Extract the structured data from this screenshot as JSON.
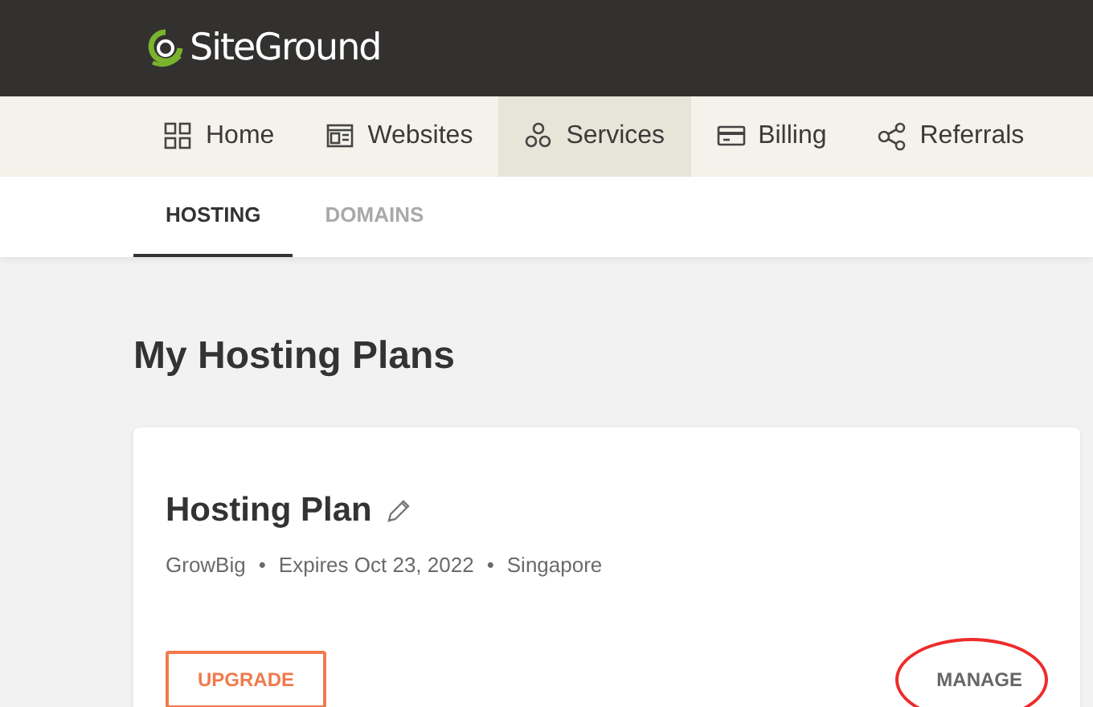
{
  "brand": {
    "name": "SiteGround"
  },
  "nav": [
    {
      "label": "Home",
      "selected": false
    },
    {
      "label": "Websites",
      "selected": false
    },
    {
      "label": "Services",
      "selected": true
    },
    {
      "label": "Billing",
      "selected": false
    },
    {
      "label": "Referrals",
      "selected": false
    }
  ],
  "subtabs": [
    {
      "label": "HOSTING",
      "selected": true
    },
    {
      "label": "DOMAINS",
      "selected": false
    }
  ],
  "heading": "My Hosting Plans",
  "plan": {
    "title": "Hosting Plan",
    "meta": [
      "GrowBig",
      "Expires Oct 23, 2022",
      "Singapore"
    ],
    "separator": "•",
    "actions": [
      {
        "label": "UPGRADE",
        "kind": "outline",
        "circled": false
      },
      {
        "label": "MANAGE",
        "kind": "text",
        "circled": true
      }
    ]
  }
}
